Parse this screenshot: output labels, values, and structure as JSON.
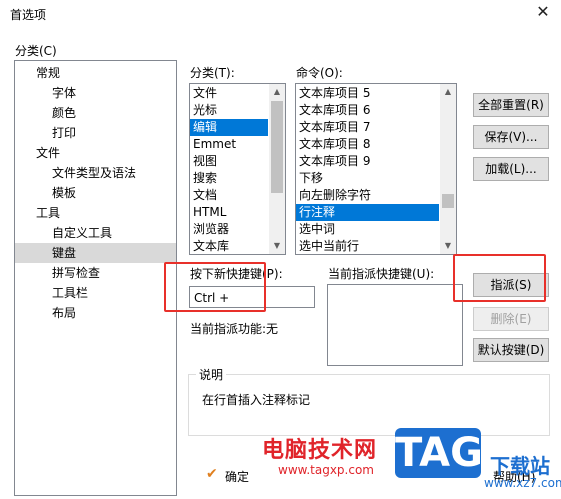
{
  "window": {
    "title": "首选项",
    "close_glyph": "✕"
  },
  "category_tree": {
    "label": "分类(C)",
    "items": [
      {
        "text": "常规",
        "level": 0
      },
      {
        "text": "字体",
        "level": 1
      },
      {
        "text": "颜色",
        "level": 1
      },
      {
        "text": "打印",
        "level": 1
      },
      {
        "text": "文件",
        "level": 0
      },
      {
        "text": "文件类型及语法",
        "level": 1
      },
      {
        "text": "模板",
        "level": 1
      },
      {
        "text": "工具",
        "level": 0
      },
      {
        "text": "自定义工具",
        "level": 1
      },
      {
        "text": "键盘",
        "level": 1,
        "selected": true
      },
      {
        "text": "拼写检查",
        "level": 1
      },
      {
        "text": "工具栏",
        "level": 1
      },
      {
        "text": "布局",
        "level": 1
      }
    ]
  },
  "categories_list": {
    "label": "分类(T):",
    "items": [
      "文件",
      "光标",
      "编辑",
      "Emmet",
      "视图",
      "搜索",
      "文档",
      "HTML",
      "浏览器",
      "文本库"
    ],
    "selected_index": 2
  },
  "commands_list": {
    "label": "命令(O):",
    "items": [
      "文本库项目 5",
      "文本库项目 6",
      "文本库项目 7",
      "文本库项目 8",
      "文本库项目 9",
      "下移",
      "向左删除字符",
      "行注释",
      "选中词",
      "选中当前行"
    ],
    "selected_index": 7
  },
  "right_buttons": {
    "reset_all": "全部重置(R)",
    "save": "保存(V)...",
    "load": "加载(L)..."
  },
  "shortcut": {
    "new_label": "按下新快捷键(P):",
    "new_value": "Ctrl +",
    "current_label": "当前指派快捷键(U):",
    "assigned_function_label": "当前指派功能:无"
  },
  "action_buttons": {
    "assign": "指派(S)",
    "delete": "删除(E)",
    "default_keys": "默认按键(D)"
  },
  "description": {
    "title": "说明",
    "text": "在行首插入注释标记"
  },
  "footer": {
    "ok": "确定",
    "help": "帮助(H)"
  },
  "watermark": {
    "site1_name": "电脑技术网",
    "site1_url": "www.tagxp.com",
    "logo": "TAG",
    "site2_name": "下载站",
    "site2_url": "www.xz7.com"
  },
  "colors": {
    "selection": "#0078d7",
    "highlight_box": "#e8302a",
    "watermark_red": "#e0242a",
    "watermark_blue": "#1d6fd0"
  }
}
